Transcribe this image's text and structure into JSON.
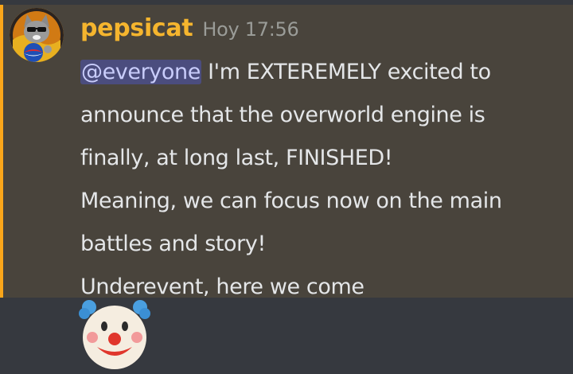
{
  "message": {
    "author": "pepsicat",
    "timestamp": "Hoy 17:56",
    "mention": "@everyone",
    "lines": [
      " I'm EXTEREMELY excited to",
      "announce that the overworld engine is",
      "finally, at long last, FINISHED!",
      "Meaning, we can focus now on the main",
      "battles and story!",
      "Underevent, here we come"
    ],
    "emoji": "clown-face"
  },
  "colors": {
    "background": "#36393f",
    "mention_highlight_bg": "#49443c",
    "mention_bar": "#faa61a",
    "username": "#f5b52e",
    "mention_chip": "#4b4d7e"
  }
}
